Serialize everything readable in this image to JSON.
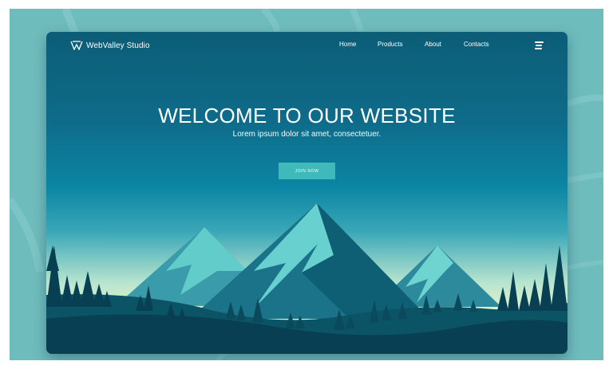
{
  "brand": {
    "name": "WebValley Studio",
    "logo_icon": "w-logo-icon"
  },
  "nav": {
    "items": [
      {
        "label": "Home"
      },
      {
        "label": "Products"
      },
      {
        "label": "About"
      },
      {
        "label": "Contacts"
      }
    ],
    "menu_icon": "hamburger-menu-icon"
  },
  "hero": {
    "title": "WELCOME TO OUR WEBSITE",
    "subtitle": "Lorem ipsum dolor sit amet, consectetuer.",
    "cta_label": "JOIN NOW"
  },
  "colors": {
    "page_background": "#6fbcbd",
    "sky_top": "#0c5d76",
    "sky_horizon": "#f2f7c6",
    "button": "#40b9bb",
    "mountain_light": "#5fcfcf",
    "mountain_dark": "#0d5b6c",
    "forest": "#083f52"
  }
}
